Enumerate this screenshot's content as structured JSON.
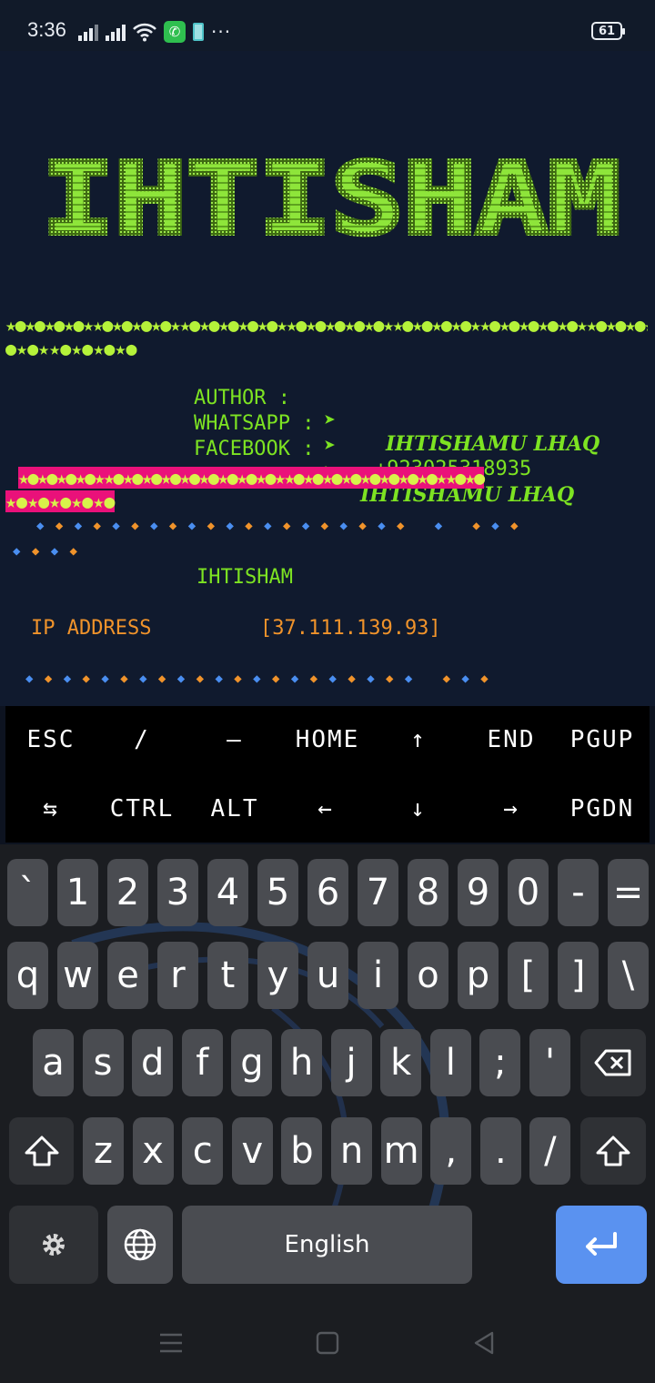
{
  "status_bar": {
    "time": "3:36",
    "battery": "61"
  },
  "terminal": {
    "banner": "IHTISHAM",
    "star_line_1": "★●★●★●★●★★●★●★●★●★★●★●★●★●★●★★●★●★●★●★●★★●★●★●★●★★●★●★●★●★●★★●★●★●★●",
    "star_line_2": "●★●★★●★●★●★●",
    "info": [
      {
        "label": "AUTHOR :",
        "arrow": "➤",
        "value": "IHTISHAMU LHAQ",
        "italic": true
      },
      {
        "label": "WHATSAPP :",
        "arrow": "➤",
        "value": "+923025318935",
        "italic": false
      },
      {
        "label": "FACEBOOK :",
        "arrow": "➤",
        "value": "IHTISHAMU LHAQ",
        "italic": true
      }
    ],
    "pink_line_1": "★●★●★●★●★★●★●★●★●★●★●★●★●★●★★●★●★●★●★●★●★●★●★★●★●",
    "pink_line_2": "★●★●★●★●★●",
    "diamond_row_1": "◆◆◆◆◆◆◆◆◆◆◆◆◆◆◆◆◆◆◆◆ ◆ ◆◆◆",
    "diamond_row_2": "◆◆◆◆",
    "diamond_row_3": "◆◆◆◆◆◆◆◆◆◆◆◆◆◆◆◆◆◆◆◆◆ ◆◆◆",
    "name": "IHTISHAM",
    "ip_label": "IP ADDRESS",
    "ip_value": "[37.111.139.93]",
    "colors": {
      "green": "#7de322",
      "pink": "#ea117a",
      "orange": "#f0932b",
      "blue": "#4a8ef0"
    }
  },
  "extra_keys": {
    "row1": [
      "ESC",
      "/",
      "—",
      "HOME",
      "↑",
      "END",
      "PGUP"
    ],
    "row2": [
      "⇆",
      "CTRL",
      "ALT",
      "←",
      "↓",
      "→",
      "PGDN"
    ]
  },
  "keyboard": {
    "row1": [
      "`",
      "1",
      "2",
      "3",
      "4",
      "5",
      "6",
      "7",
      "8",
      "9",
      "0",
      "-",
      "="
    ],
    "row2": [
      "q",
      "w",
      "e",
      "r",
      "t",
      "y",
      "u",
      "i",
      "o",
      "p",
      "[",
      "]",
      "\\"
    ],
    "row3": [
      "a",
      "s",
      "d",
      "f",
      "g",
      "h",
      "j",
      "k",
      "l",
      ";",
      "'"
    ],
    "row4": [
      "z",
      "x",
      "c",
      "v",
      "b",
      "n",
      "m",
      ",",
      ".",
      "/"
    ],
    "space_label": "English"
  }
}
